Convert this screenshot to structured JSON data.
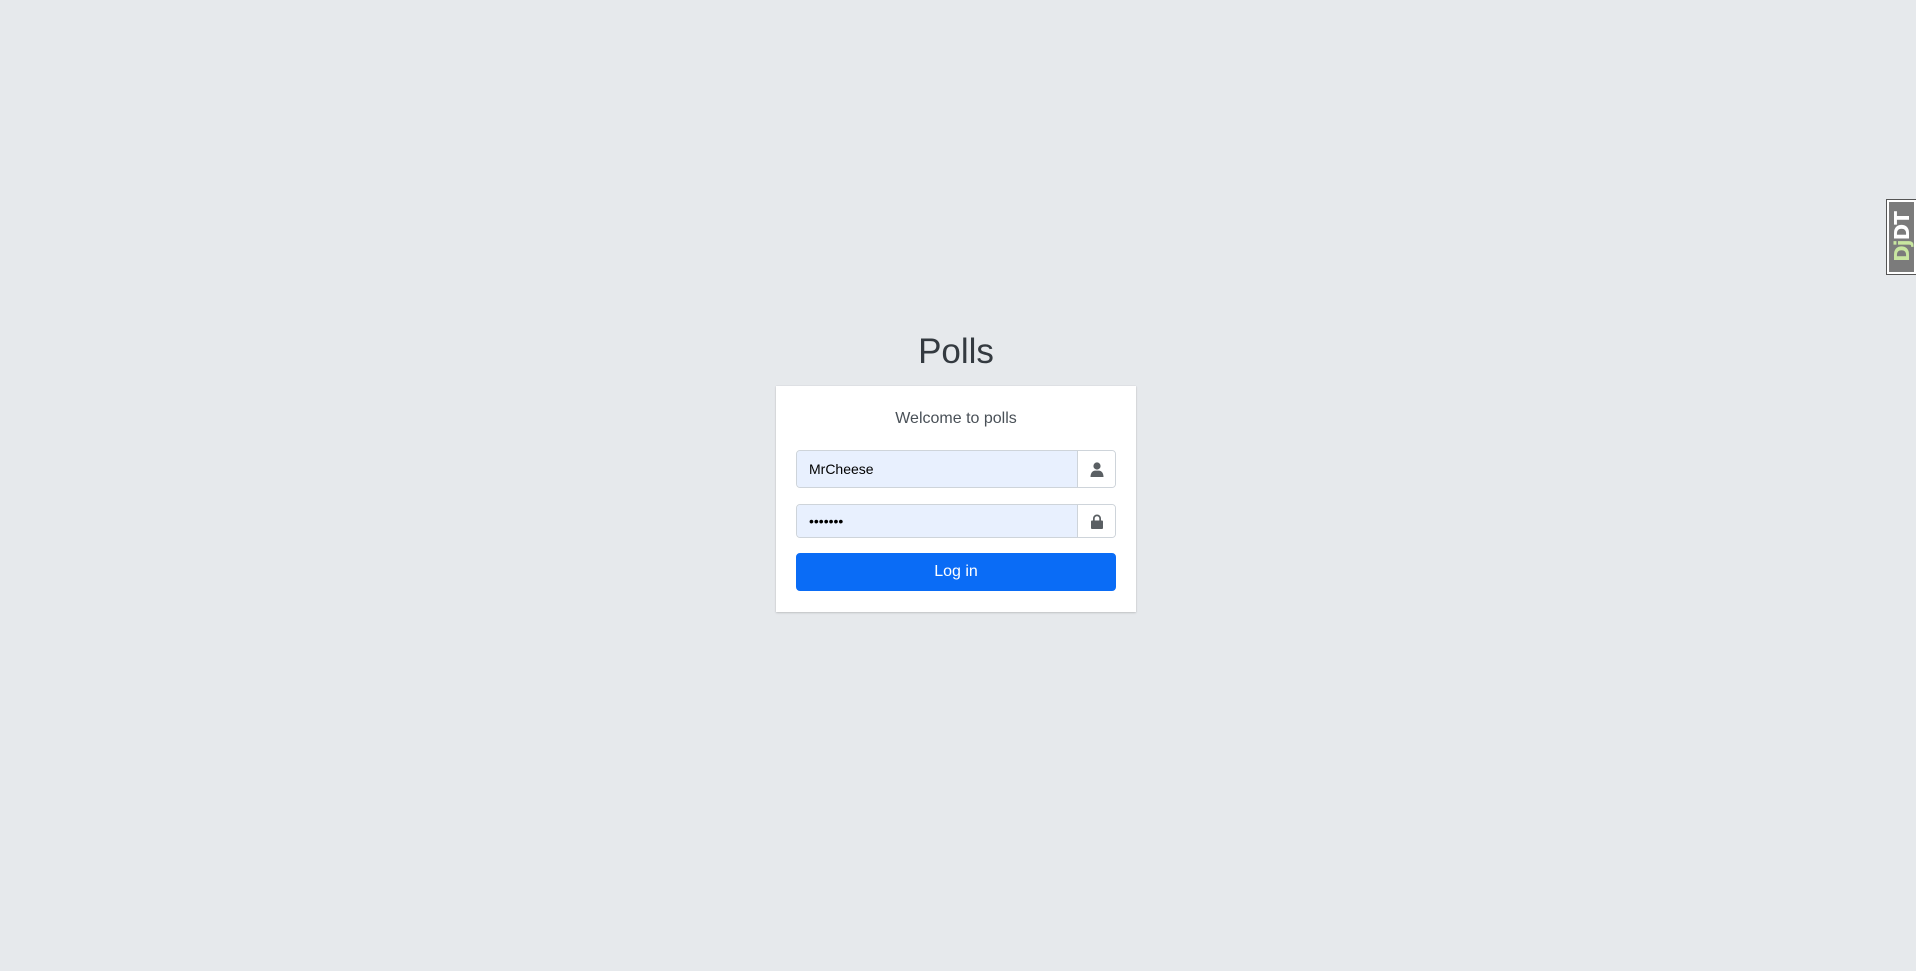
{
  "page": {
    "title": "Polls"
  },
  "login_card": {
    "message": "Welcome to polls",
    "username": {
      "value": "MrCheese",
      "icon": "user-icon"
    },
    "password": {
      "value": "•••••••",
      "icon": "lock-icon"
    },
    "submit_label": "Log in"
  },
  "debug_toolbar": {
    "label_prefix": "Dj",
    "label_suffix": "DT"
  },
  "colors": {
    "background": "#e6e9ec",
    "primary": "#0a6cf6",
    "autofill": "#e8f0fe"
  }
}
